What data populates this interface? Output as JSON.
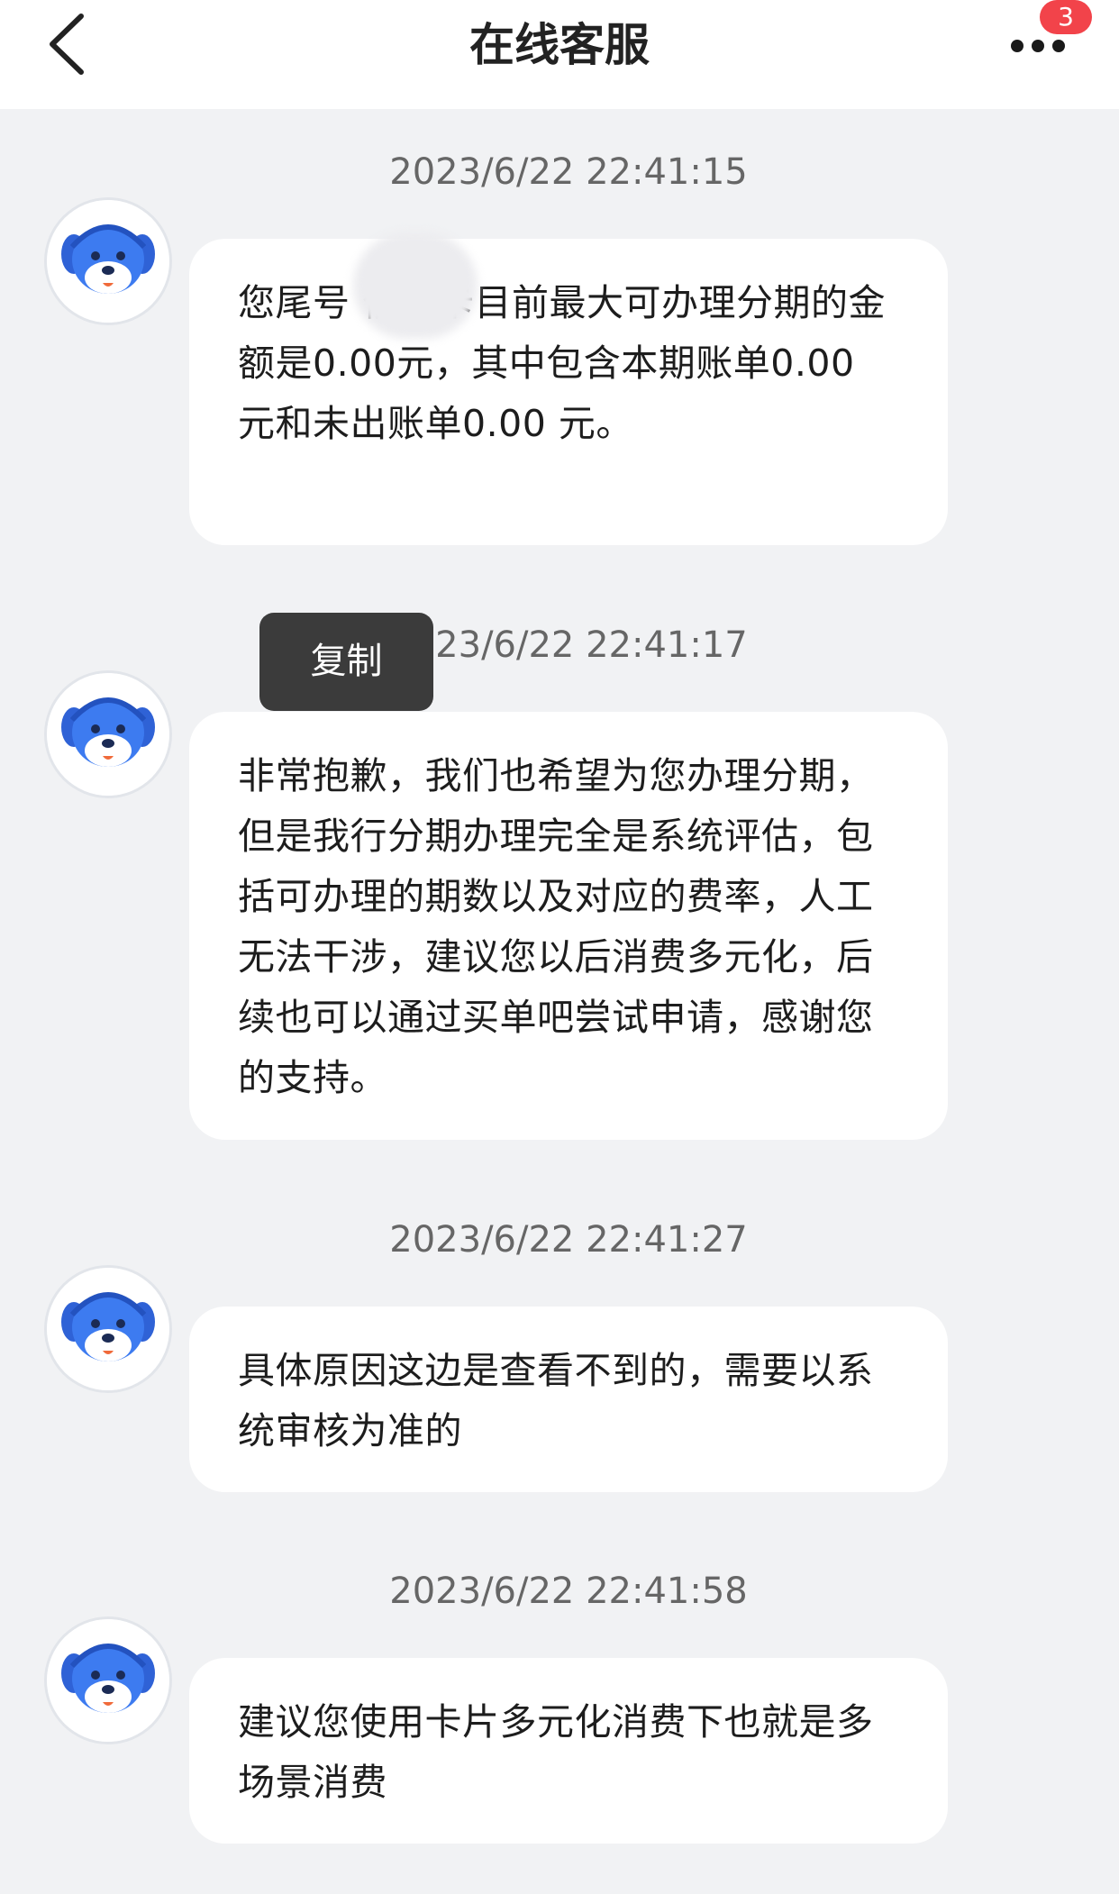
{
  "header": {
    "title": "在线客服",
    "badge_count": "3"
  },
  "messages": [
    {
      "timestamp": "2023/6/22 22:41:15",
      "text": "您尾号  信用卡目前最大可办理分期的金额是0.00元，其中包含本期账单0.00 元和未出账单0.00 元。"
    },
    {
      "timestamp": "2023/6/22 22:41:17",
      "text": "非常抱歉，我们也希望为您办理分期，但是我行分期办理完全是系统评估，包括可办理的期数以及对应的费率，人工无法干涉，建议您以后消费多元化，后续也可以通过买单吧尝试申请，感谢您的支持。"
    },
    {
      "timestamp": "2023/6/22 22:41:27",
      "text": "具体原因这边是查看不到的，需要以系统审核为准的"
    },
    {
      "timestamp": "2023/6/22 22:41:58",
      "text": "建议您使用卡片多元化消费下也就是多场景消费"
    }
  ],
  "context_menu": {
    "copy_label": "复制"
  },
  "colors": {
    "background": "#f1f2f4",
    "bubble": "#ffffff",
    "badge": "#f2434a",
    "popup": "#3b3b3b",
    "avatar_blue": "#3d7bf0"
  }
}
